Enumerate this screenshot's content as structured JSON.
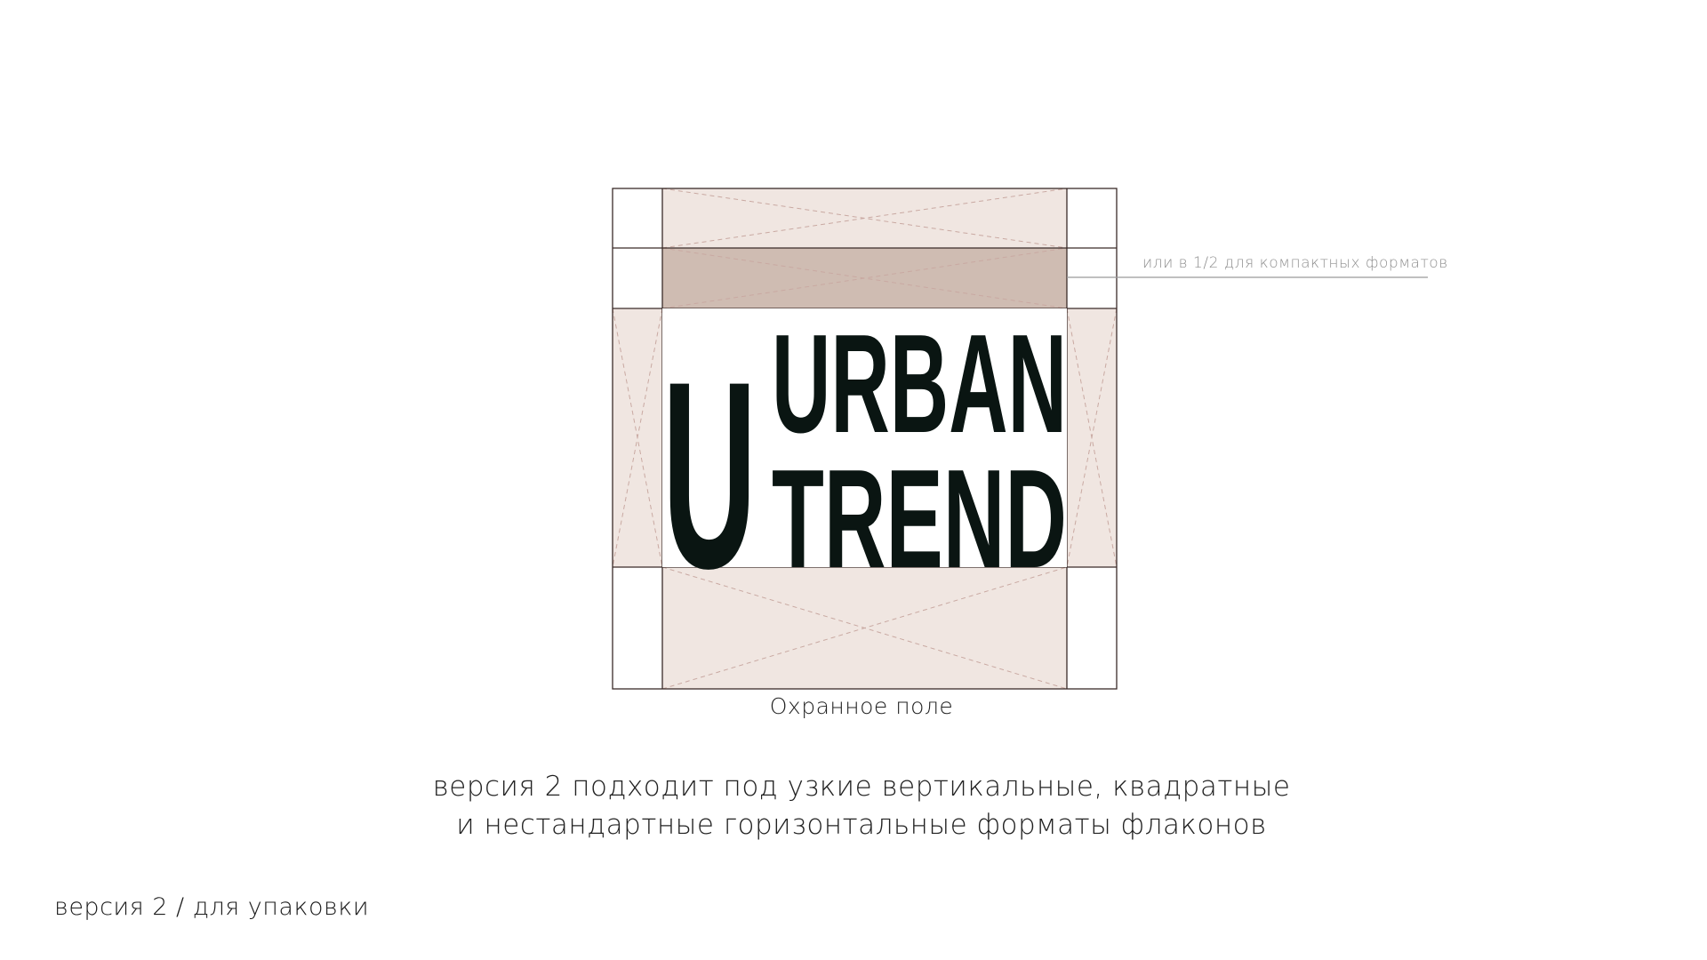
{
  "logo": {
    "initial": "U",
    "line1": "URBAN",
    "line2": "TREND"
  },
  "clear_space_label": "Охранное поле",
  "compact_note": "или в 1/2 для компактных форматов",
  "description": {
    "line1": "версия 2 подходит под узкие вертикальные, квадратные",
    "line2": "и нестандартные горизонтальные форматы флаконов"
  },
  "footer_caption": "версия 2 / для упаковки",
  "colors": {
    "background": "#ffffff",
    "clear_space_fill": "#f0e6e1",
    "compact_band_fill": "#cfbcb2",
    "guide_line": "#3a2b28",
    "logo_ink": "#0a1512",
    "note_text": "#8f8f8f"
  }
}
